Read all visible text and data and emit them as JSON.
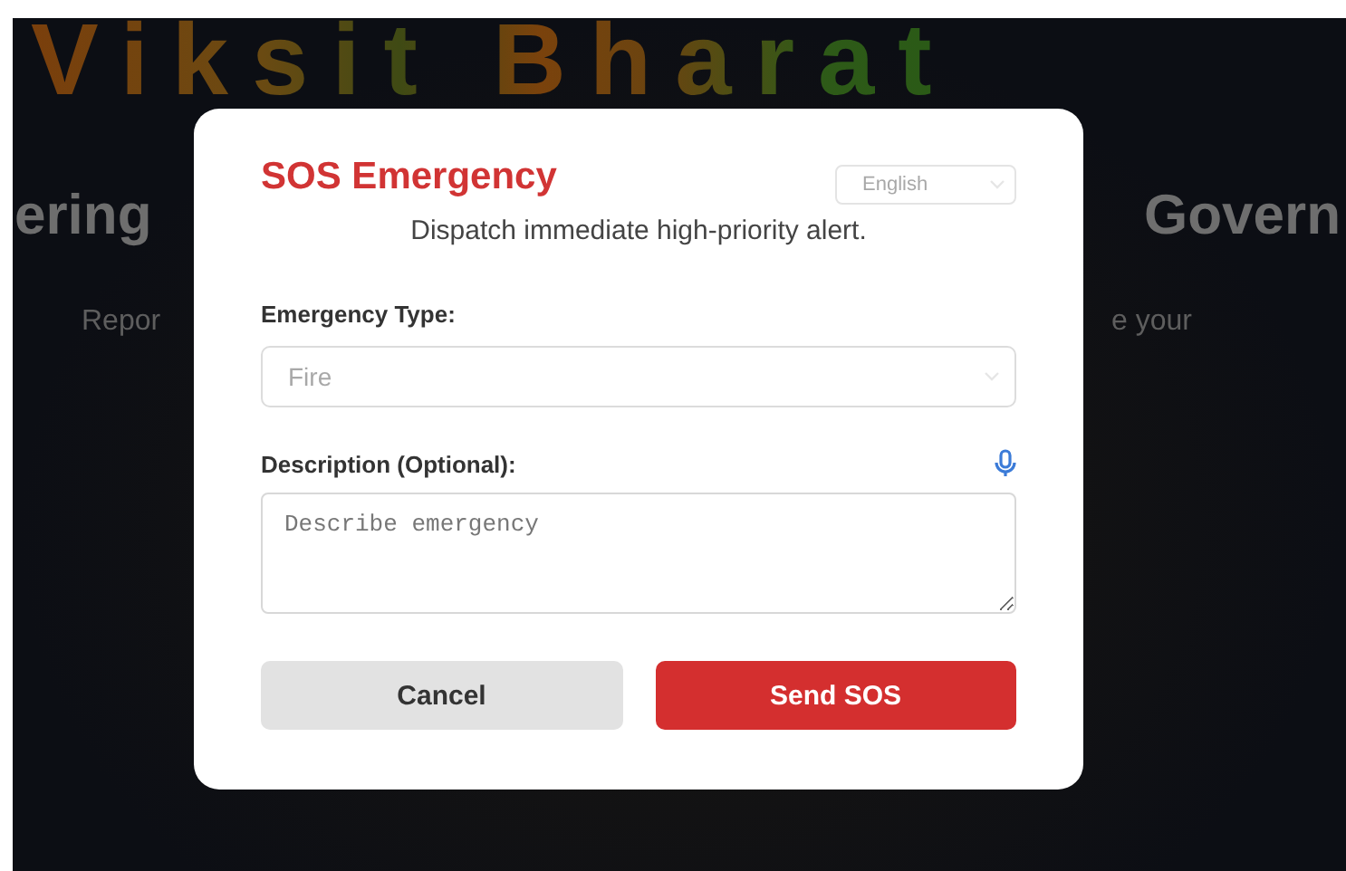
{
  "background": {
    "headline": "Viksit Bharat",
    "tagline_left": "ering",
    "tagline_right": "Govern",
    "intro_left": "Repor",
    "intro_right": "e your"
  },
  "dialog": {
    "title": "SOS Emergency",
    "language": {
      "value": "English"
    },
    "subtitle": "Dispatch immediate high-priority alert.",
    "type_label": "Emergency Type:",
    "type_value": "Fire",
    "description_label": "Description (Optional):",
    "description": {
      "placeholder": "Describe emergency"
    },
    "buttons": [
      {
        "label": "Cancel",
        "kind": "secondary"
      },
      {
        "label": "Send SOS",
        "kind": "primary"
      }
    ]
  }
}
